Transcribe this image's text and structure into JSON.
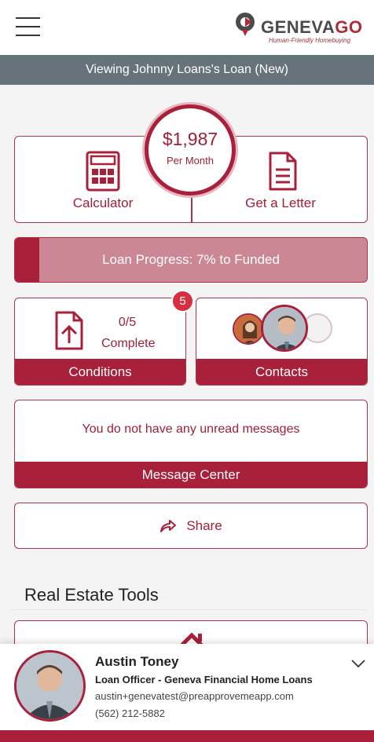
{
  "app": {
    "brand_name_main": "GENEVA",
    "brand_name_accent": "GO",
    "brand_tagline": "Human-Friendly Homebuying",
    "menu_icon": "hamburger-menu-icon"
  },
  "viewing_banner": "Viewing Johnny Loans's Loan (New)",
  "payment": {
    "amount": "$1,987",
    "period": "Per Month",
    "calculator_label": "Calculator",
    "letter_label": "Get a Letter"
  },
  "progress": {
    "label": "Loan Progress: 7% to Funded",
    "percent": 7
  },
  "conditions": {
    "count": "0/5",
    "status": "Complete",
    "label": "Conditions",
    "badge": "5"
  },
  "contacts": {
    "label": "Contacts"
  },
  "messages": {
    "text": "You do not have any unread messages",
    "label": "Message Center"
  },
  "share": {
    "label": "Share"
  },
  "real_estate_tools": {
    "title": "Real Estate Tools"
  },
  "loan_officer": {
    "name": "Austin Toney",
    "title": "Loan Officer - Geneva Financial Home Loans",
    "email": "austin+genevatest@preapprovemeapp.com",
    "phone": "(562) 212-5882"
  },
  "colors": {
    "brand_maroon": "#a8203a",
    "progress_bg": "#cc8794",
    "banner_gray": "#66737b",
    "badge_red": "#d63040"
  }
}
